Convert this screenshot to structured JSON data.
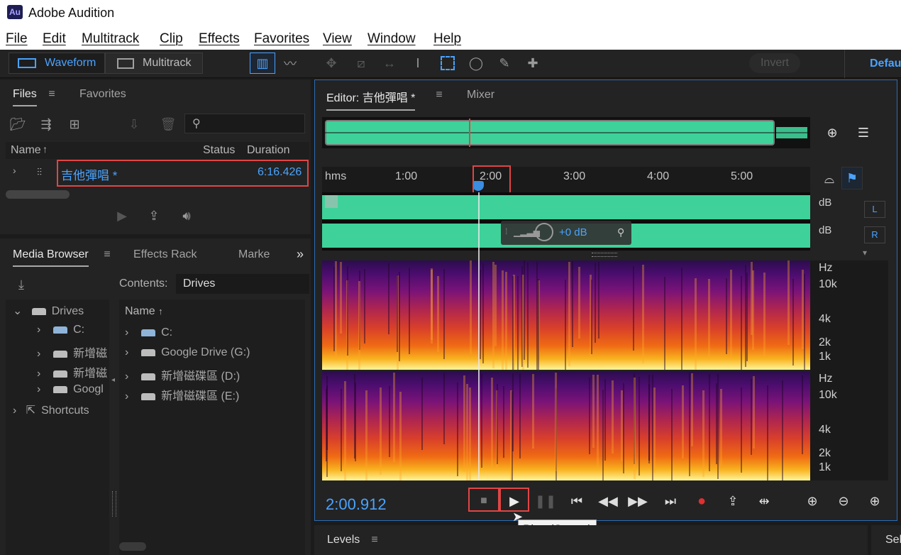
{
  "window": {
    "app_icon": "Au",
    "title": "Adobe Audition"
  },
  "menu": [
    "File",
    "Edit",
    "Multitrack",
    "Clip",
    "Effects",
    "Favorites",
    "View",
    "Window",
    "Help"
  ],
  "toolbar": {
    "waveform_label": "Waveform",
    "multitrack_label": "Multitrack",
    "invert_label": "Invert",
    "workspace_label": "Defau"
  },
  "files_panel": {
    "tabs": [
      "Files",
      "Favorites"
    ],
    "columns": {
      "name": "Name",
      "status": "Status",
      "duration": "Duration"
    },
    "files": [
      {
        "name": "吉他彈唱 *",
        "duration": "6:16.426"
      }
    ]
  },
  "media_browser": {
    "tabs": [
      "Media Browser",
      "Effects Rack",
      "Marke"
    ],
    "contents_label": "Contents:",
    "contents_value": "Drives",
    "tree": {
      "drives_label": "Drives",
      "items": [
        "C:",
        "新增磁",
        "新增磁",
        "Googl"
      ],
      "shortcuts_label": "Shortcuts"
    },
    "list_header": "Name",
    "list": [
      "C:",
      "Google Drive (G:)",
      "新增磁碟區 (D:)",
      "新增磁碟區 (E:)"
    ]
  },
  "editor": {
    "tab_label": "Editor: 吉他彈唱 *",
    "mixer_label": "Mixer",
    "ruler": {
      "unit": "hms",
      "ticks": [
        "1:00",
        "2:00",
        "3:00",
        "4:00",
        "5:00"
      ]
    },
    "channel_db_label": "dB",
    "left_channel": "L",
    "right_channel": "R",
    "hud_gain": "+0 dB",
    "spectral_labels": {
      "unit": "Hz",
      "ticks": [
        "10k",
        "4k",
        "2k",
        "1k"
      ]
    },
    "current_time": "2:00.912",
    "playhead_fraction": 0.32,
    "tooltip": "Play (Space)"
  },
  "levels_panel": {
    "label": "Levels",
    "right_label": "Sel"
  },
  "colors": {
    "waveform": "#3ed29a",
    "accent_blue": "#4aa3ff",
    "highlight_red": "#e04545",
    "record_red": "#e03030"
  }
}
